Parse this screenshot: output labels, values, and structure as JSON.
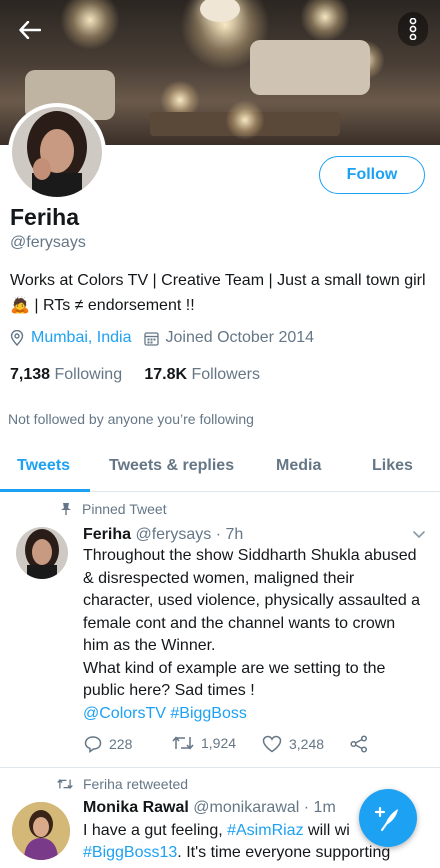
{
  "profile": {
    "name": "Feriha",
    "handle": "@ferysays",
    "bio": "Works at Colors TV | Creative Team | Just a small town girl 🙇 | RTs ≠ endorsement !!",
    "location": "Mumbai, India",
    "joined": "Joined October 2014",
    "following_count": "7,138",
    "following_label": "Following",
    "followers_count": "17.8K",
    "followers_label": "Followers",
    "not_followed": "Not followed by anyone you’re following"
  },
  "follow_label": "Follow",
  "tabs": [
    {
      "label": "Tweets",
      "active": true
    },
    {
      "label": "Tweets & replies",
      "active": false
    },
    {
      "label": "Media",
      "active": false
    },
    {
      "label": "Likes",
      "active": false
    }
  ],
  "pinned_tweet": {
    "pin_label": "Pinned Tweet",
    "author": "Feriha",
    "handle": "@ferysays",
    "time": "· 7h",
    "text": "Throughout the show Siddharth Shukla abused & disrespected women, maligned their character, used violence, physically assaulted a female cont and the channel wants to crown him as the Winner.",
    "text2": "What kind of example are we setting to the public here? Sad times !",
    "mention": "@ColorsTV",
    "hashtag": "#BiggBoss",
    "replies": "228",
    "retweets": "1,924",
    "likes": "3,248"
  },
  "retweet": {
    "rt_label": "Feriha retweeted",
    "author": "Monika Rawal",
    "handle": "@monikarawal",
    "time": "· 1m",
    "text_a": "I have a gut feeling, ",
    "hashtag_a": "#AsimRiaz",
    "text_b": " will wi",
    "hashtag_b": "#BiggBoss13",
    "text_c": ". It's time everyone supporting"
  },
  "colors": {
    "accent": "#1da1f2",
    "secondary_text": "#657786",
    "primary_text": "#14171a"
  }
}
